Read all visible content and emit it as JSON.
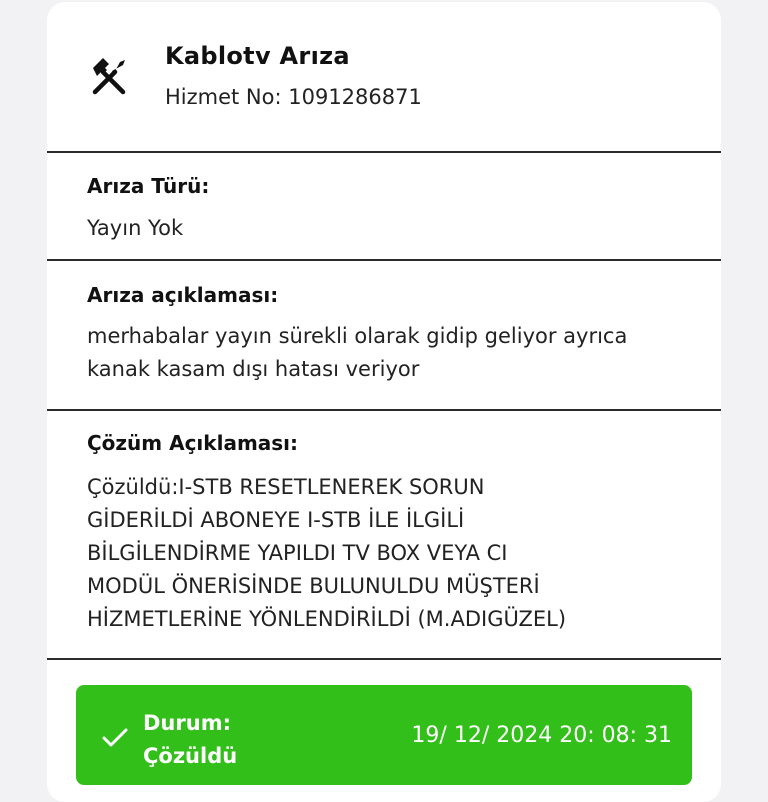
{
  "header": {
    "title": "Kablotv Arıza",
    "service_no": "Hizmet No: 1091286871",
    "icon": "tools-icon"
  },
  "fault_type": {
    "label": "Arıza Türü:",
    "value": "Yayın Yok"
  },
  "fault_description": {
    "label": "Arıza açıklaması:",
    "lines": [
      "merhabalar yayın sürekli olarak gidip geliyor ayrıca",
      "kanak kasam dışı hatası veriyor"
    ]
  },
  "solution_description": {
    "label": "Çözüm Açıklaması:",
    "lines": [
      "Çözüldü:I-STB RESETLENEREK SORUN",
      "GİDERİLDİ ABONEYE I-STB İLE İLGİLİ",
      "BİLGİLENDİRME YAPILDI TV BOX VEYA CI",
      "MODÜL ÖNERİSİNDE BULUNULDU MÜŞTERİ",
      "HİZMETLERİNE YÖNLENDİRİLDİ (M.ADIGÜZEL)"
    ]
  },
  "status": {
    "label_line1": "Durum:",
    "label_line2": "Çözüldü",
    "datetime": "19/ 12/ 2024 20: 08: 31",
    "color": "#33bf1a",
    "icon": "check-icon"
  }
}
